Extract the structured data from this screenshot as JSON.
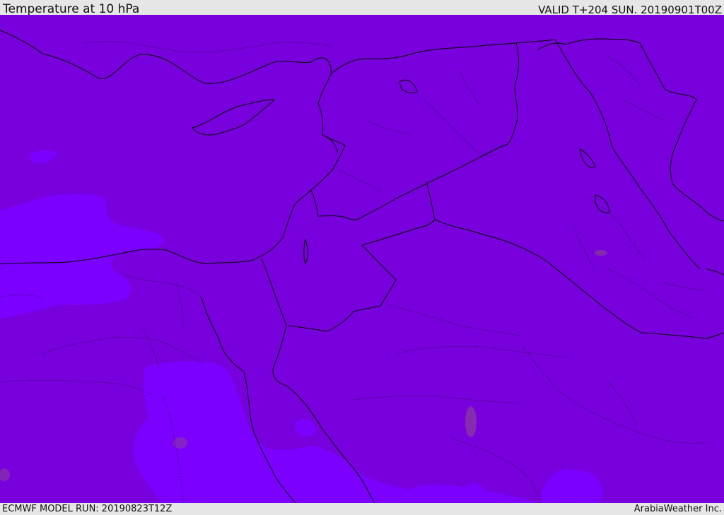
{
  "header": {
    "title": "Temperature at 10 hPa",
    "valid": "VALID T+204 SUN. 20190901T00Z"
  },
  "footer": {
    "model_run": "ECMWF MODEL RUN: 20190823T12Z",
    "credit": "ArabiaWeather Inc."
  },
  "colors": {
    "base_fill": "#7800dc",
    "warm_fill": "#7b00ff",
    "cold_spot": "#8a3a9e",
    "border": "#000000"
  }
}
